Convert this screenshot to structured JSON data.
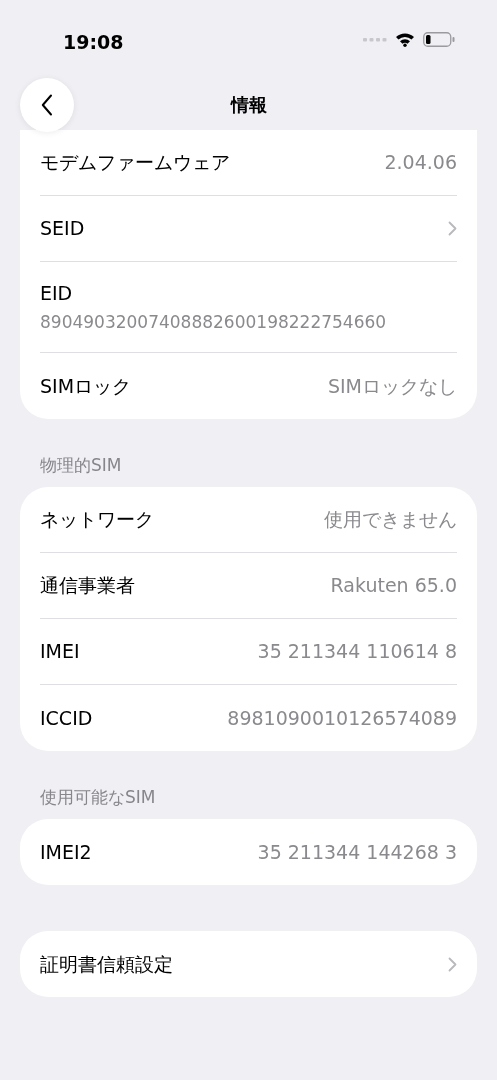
{
  "status_bar": {
    "time": "19:08"
  },
  "header": {
    "title": "情報"
  },
  "sections": [
    {
      "rows": [
        {
          "kind": "value",
          "label": "モデムファームウェア",
          "value": "2.04.06"
        },
        {
          "kind": "chevron",
          "label": "SEID"
        },
        {
          "kind": "subtitle",
          "label": "EID",
          "value": "89049032007408882600198222754660"
        },
        {
          "kind": "value",
          "label": "SIMロック",
          "value": "SIMロックなし"
        }
      ]
    },
    {
      "title": "物理的SIM",
      "rows": [
        {
          "kind": "value",
          "label": "ネットワーク",
          "value": "使用できません"
        },
        {
          "kind": "value",
          "label": "通信事業者",
          "value": "Rakuten 65.0"
        },
        {
          "kind": "value",
          "label": "IMEI",
          "value": "35 211344 110614 8"
        },
        {
          "kind": "value",
          "label": "ICCID",
          "value": "8981090010126574089"
        }
      ]
    },
    {
      "title": "使用可能なSIM",
      "rows": [
        {
          "kind": "value",
          "label": "IMEI2",
          "value": "35 211344 144268 3"
        }
      ]
    },
    {
      "rows": [
        {
          "kind": "chevron",
          "label": "証明書信頼設定"
        }
      ]
    }
  ]
}
